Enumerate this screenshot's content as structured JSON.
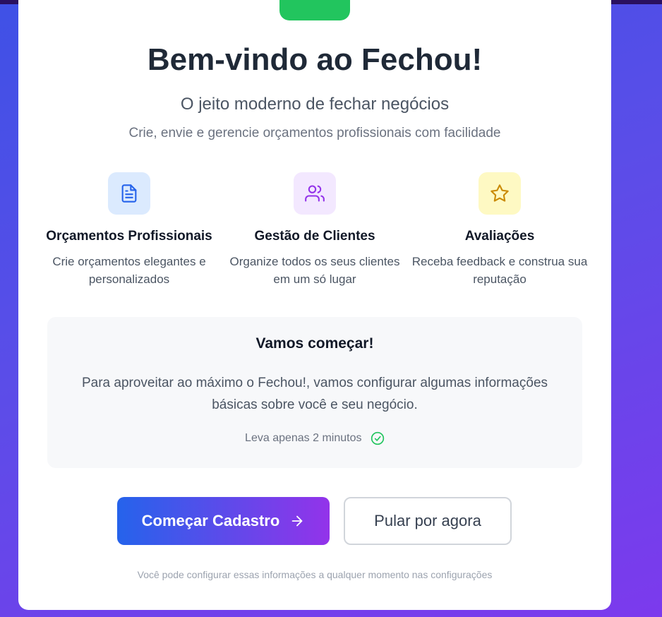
{
  "header": {
    "title": "Bem-vindo ao Fechou!",
    "subtitle": "O jeito moderno de fechar negócios",
    "tagline": "Crie, envie e gerencie orçamentos profissionais com facilidade"
  },
  "features": [
    {
      "icon": "document-icon",
      "title": "Orçamentos Profissionais",
      "description": "Crie orçamentos elegantes e personalizados",
      "color": "#2563eb",
      "bg": "#dbeafe"
    },
    {
      "icon": "users-icon",
      "title": "Gestão de Clientes",
      "description": "Organize todos os seus clientes em um só lugar",
      "color": "#9333ea",
      "bg": "#f3e8ff"
    },
    {
      "icon": "star-icon",
      "title": "Avaliações",
      "description": "Receba feedback e construa sua reputação",
      "color": "#ca8a04",
      "bg": "#fef9c3"
    }
  ],
  "start_section": {
    "title": "Vamos começar!",
    "description": "Para aproveitar ao máximo o Fechou!, vamos configurar algumas informações básicas sobre você e seu negócio.",
    "time_note": "Leva apenas 2 minutos",
    "time_icon": "check-circle-icon",
    "time_icon_color": "#22c55e"
  },
  "actions": {
    "primary_label": "Começar Cadastro",
    "primary_icon": "arrow-right-icon",
    "secondary_label": "Pular por agora"
  },
  "footnote": "Você pode configurar essas informações a qualquer momento nas configurações",
  "colors": {
    "accent_green": "#22c55e",
    "gradient_start": "#2563eb",
    "gradient_end": "#9333ea",
    "background_start": "#3f51e6",
    "background_end": "#7c3aed"
  }
}
